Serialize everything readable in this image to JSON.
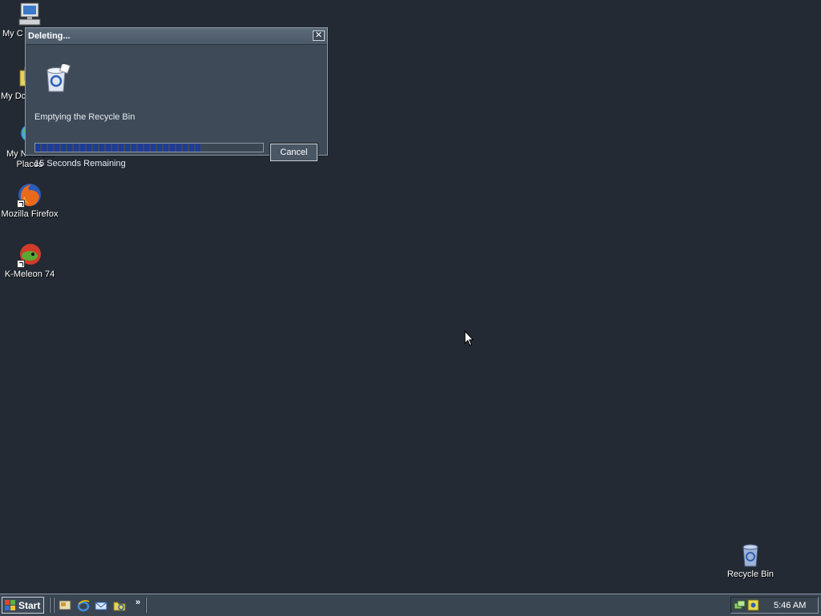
{
  "desktop": {
    "icons": [
      {
        "label": "My Computer",
        "visible_label": "My C",
        "icon": "computer-icon"
      },
      {
        "label": "My Documents",
        "visible_label": "My Dc",
        "icon": "documents-folder-icon"
      },
      {
        "label": "My Network Places",
        "visible_label_line1": "My Network",
        "visible_label_line2": "Places",
        "icon": "network-icon"
      },
      {
        "label": "Mozilla Firefox",
        "icon": "firefox-icon"
      },
      {
        "label": "K-Meleon 74",
        "icon": "kmeleon-icon"
      },
      {
        "label": "Recycle Bin",
        "icon": "recycle-bin-icon"
      }
    ]
  },
  "dialog": {
    "title": "Deleting...",
    "close_symbol": "✕",
    "status_text": "Emptying the Recycle Bin",
    "progress_fraction": 0.73,
    "time_remaining": "15 Seconds Remaining",
    "cancel_label": "Cancel"
  },
  "taskbar": {
    "start_label": "Start",
    "quick_launch": [
      "desktop-icon",
      "ie-icon",
      "outlook-icon",
      "explorer-icon"
    ],
    "overflow_symbol": "»",
    "clock": "5:46 AM"
  },
  "colors": {
    "desktop": "#232a33",
    "dialog": "#3e4a57",
    "progress": "#1d3b97"
  }
}
